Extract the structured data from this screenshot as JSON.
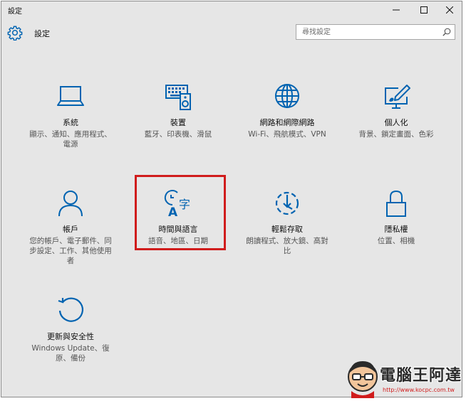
{
  "window": {
    "title": "設定",
    "controls": [
      "minimize-icon",
      "maximize-icon",
      "close-icon"
    ]
  },
  "header": {
    "title": "設定",
    "icon": "gear-icon",
    "search_placeholder": "尋找設定",
    "search_value": ""
  },
  "colors": {
    "accent": "#0063b1",
    "background": "#e6e6e6",
    "highlight": "#d01c1c"
  },
  "tiles": [
    {
      "id": "system",
      "icon": "laptop-icon",
      "name": "系統",
      "desc": "顯示、通知、應用程式、電源"
    },
    {
      "id": "devices",
      "icon": "keyboard-speaker-icon",
      "name": "裝置",
      "desc": "藍牙、印表機、滑鼠"
    },
    {
      "id": "network",
      "icon": "globe-icon",
      "name": "網路和網際網路",
      "desc": "Wi-Fi、飛航模式、VPN"
    },
    {
      "id": "personalization",
      "icon": "paint-monitor-icon",
      "name": "個人化",
      "desc": "背景、鎖定畫面、色彩"
    },
    {
      "id": "accounts",
      "icon": "person-icon",
      "name": "帳戶",
      "desc": "您的帳戶、電子郵件、同步設定、工作、其他使用者"
    },
    {
      "id": "time-language",
      "icon": "clock-language-icon",
      "name": "時間與語言",
      "desc": "語音、地區、日期"
    },
    {
      "id": "ease-of-access",
      "icon": "ease-of-access-icon",
      "name": "輕鬆存取",
      "desc": "朗讀程式、放大鏡、高對比"
    },
    {
      "id": "privacy",
      "icon": "lock-icon",
      "name": "隱私權",
      "desc": "位置、相機"
    },
    {
      "id": "update-security",
      "icon": "refresh-icon",
      "name": "更新與安全性",
      "desc": "Windows Update、復原、備份"
    }
  ],
  "watermark": {
    "text": "電腦王阿達",
    "url": "http://www.kocpc.com.tw"
  }
}
